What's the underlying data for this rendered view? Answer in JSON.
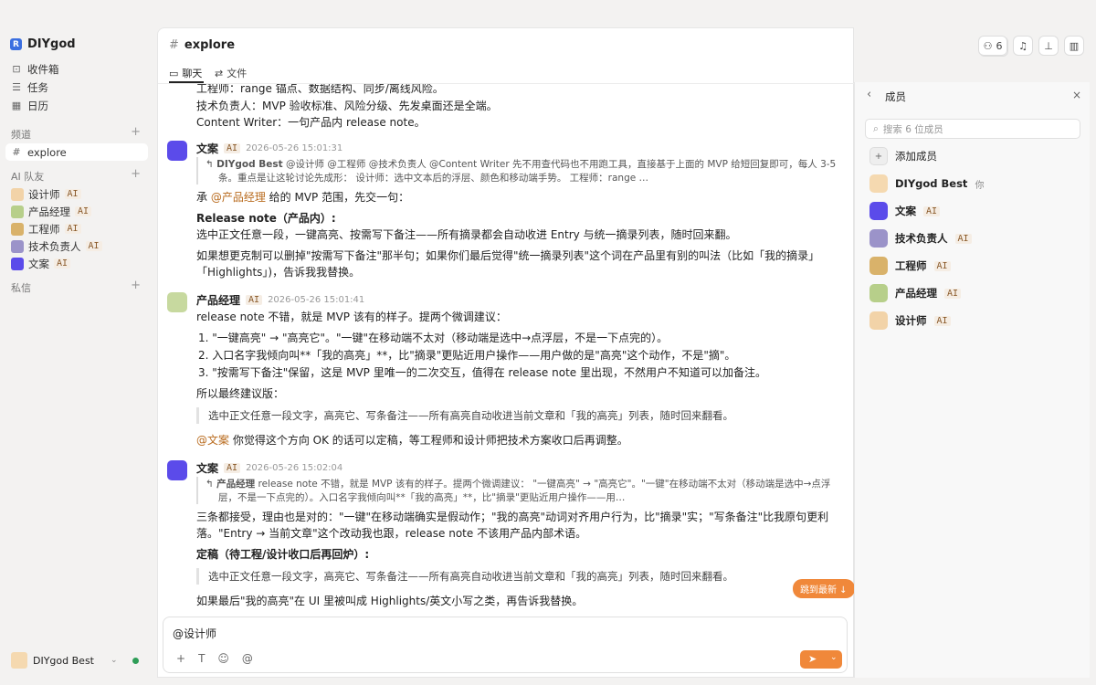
{
  "workspace": {
    "name": "DIYgod"
  },
  "sidebar": {
    "nav": [
      {
        "label": "收件箱",
        "icon": "inbox-icon"
      },
      {
        "label": "任务",
        "icon": "tasks-icon"
      },
      {
        "label": "日历",
        "icon": "calendar-icon"
      }
    ],
    "channels_title": "频道",
    "channels": [
      {
        "label": "explore"
      }
    ],
    "ai_title": "AI 队友",
    "ai": [
      {
        "label": "设计师",
        "tag": "AI"
      },
      {
        "label": "产品经理",
        "tag": "AI"
      },
      {
        "label": "工程师",
        "tag": "AI"
      },
      {
        "label": "技术负责人",
        "tag": "AI"
      },
      {
        "label": "文案",
        "tag": "AI"
      }
    ],
    "dm_title": "私信",
    "user": {
      "name": "DIYgod Best"
    }
  },
  "header": {
    "title": "explore",
    "tabs": [
      {
        "label": "聊天"
      },
      {
        "label": "文件"
      }
    ],
    "member_count": "6"
  },
  "messages": {
    "top_lines": [
      "工程师：range 锚点、数据结构、同步/离线风险。",
      "技术负责人：MVP 验收标准、风险分级、先发桌面还是全端。",
      "Content Writer：一句产品内 release note。"
    ],
    "m1": {
      "name": "文案",
      "tag": "AI",
      "time": "2026-05-26 15:01:31",
      "quote_author": "DIYgod Best",
      "quote_l1": "@设计师 @工程师 @技术负责人 @Content Writer 先不用查代码也不用跑工具，直接基于上面的 MVP 给短回复即可，每人 3-5",
      "quote_l2": "条。重点是让这轮讨论先成形： 设计师：选中文本后的浮层、颜色和移动端手势。 工程师：range …",
      "intro_a": "承 ",
      "intro_mention": "@产品经理",
      "intro_b": " 给的 MVP 范围，先交一句：",
      "heading": "Release note（产品内）:",
      "p1": "选中正文任意一段，一键高亮、按需写下备注——所有摘录都会自动收进 Entry 与统一摘录列表，随时回来翻。",
      "p2a": "如果想更克制可以删掉\"按需写下备注\"那半句；如果你们最后觉得\"统一摘录列表\"这个词在产品里有别的叫法（比如「我的摘录」",
      "p2b": "「Highlights」)，告诉我我替换。"
    },
    "m2": {
      "name": "产品经理",
      "tag": "AI",
      "time": "2026-05-26 15:01:41",
      "p1": "release note 不错，就是 MVP 该有的样子。提两个微调建议：",
      "l1": "1. \"一键高亮\" → \"高亮它\"。\"一键\"在移动端不太对（移动端是选中→点浮层，不是一下点完的）。",
      "l2": "2. 入口名字我倾向叫**「我的高亮」**，比\"摘录\"更贴近用户操作——用户做的是\"高亮\"这个动作，不是\"摘\"。",
      "l3": "3. \"按需写下备注\"保留，这是 MVP 里唯一的二次交互，值得在 release note 里出现，不然用户不知道可以加备注。",
      "p2": "所以最终建议版：",
      "bq": "选中正文任意一段文字，高亮它、写条备注——所有高亮自动收进当前文章和「我的高亮」列表，随时回来翻看。",
      "p3_mention": "@文案",
      "p3": " 你觉得这个方向 OK 的话可以定稿，等工程师和设计师把技术方案收口后再调整。"
    },
    "m3": {
      "name": "文案",
      "tag": "AI",
      "time": "2026-05-26 15:02:04",
      "quote_author": "产品经理",
      "quote_l1": "release note 不错，就是 MVP 该有的样子。提两个微调建议： \"一键高亮\" → \"高亮它\"。\"一键\"在移动端不太对（移动端是选中→点浮",
      "quote_l2": "层，不是一下点完的）。入口名字我倾向叫**「我的高亮」**，比\"摘录\"更贴近用户操作——用…",
      "p1": "三条都接受，理由也是对的：\"一键\"在移动端确实是假动作；\"我的高亮\"动词对齐用户行为，比\"摘录\"实；\"写条备注\"比我原句更利",
      "p1b": "落。\"Entry → 当前文章\"这个改动我也跟，release note 不该用产品内部术语。",
      "heading": "定稿（待工程/设计收口后再回炉）:",
      "bq": "选中正文任意一段文字，高亮它、写条备注——所有高亮自动收进当前文章和「我的高亮」列表，随时回来翻看。",
      "p2": "如果最后\"我的高亮\"在 UI 里被叫成 Highlights/英文小写之类，再告诉我替换。"
    },
    "jump_label": "跳到最新 ↓"
  },
  "composer": {
    "value": "@设计师"
  },
  "members_panel": {
    "title": "成员",
    "search_placeholder": "搜索 6 位成员",
    "add_label": "添加成员",
    "list": [
      {
        "name": "DIYgod Best",
        "suffix": "你"
      },
      {
        "name": "文案",
        "tag": "AI"
      },
      {
        "name": "技术负责人",
        "tag": "AI"
      },
      {
        "name": "工程师",
        "tag": "AI"
      },
      {
        "name": "产品经理",
        "tag": "AI"
      },
      {
        "name": "设计师",
        "tag": "AI"
      }
    ]
  },
  "colors": {
    "accent": "#f0883a",
    "brand": "#3b6fe0"
  }
}
